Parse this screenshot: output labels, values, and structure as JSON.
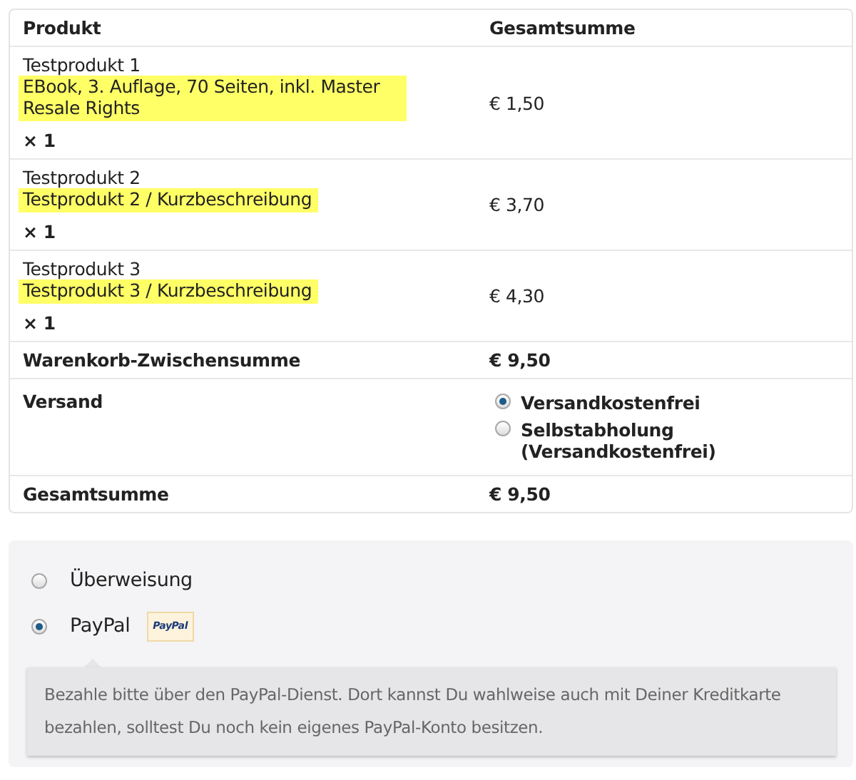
{
  "table": {
    "columns": [
      "Produkt",
      "Gesamtsumme"
    ],
    "items": [
      {
        "name": "Testprodukt 1",
        "description": "EBook, 3. Auflage, 70 Seiten, inkl. Master Resale Rights",
        "quantity": "× 1",
        "total": "€ 1,50"
      },
      {
        "name": "Testprodukt 2",
        "description": "Testprodukt 2 / Kurzbeschreibung",
        "quantity": "× 1",
        "total": "€ 3,70"
      },
      {
        "name": "Testprodukt 3",
        "description": "Testprodukt 3 / Kurzbeschreibung",
        "quantity": "× 1",
        "total": "€ 4,30"
      }
    ],
    "subtotal": {
      "label": "Warenkorb-Zwischensumme",
      "value": "€ 9,50"
    },
    "shipping": {
      "label": "Versand",
      "options": [
        {
          "label": "Versandkostenfrei",
          "selected": true
        },
        {
          "label": "Selbstabholung (Versandkostenfrei)",
          "selected": false
        }
      ]
    },
    "total": {
      "label": "Gesamtsumme",
      "value": "€ 9,50"
    }
  },
  "payment": {
    "methods": [
      {
        "label": "Überweisung",
        "selected": false
      },
      {
        "label": "PayPal",
        "selected": true,
        "logo_text": "PayPal"
      }
    ],
    "description": "Bezahle bitte über den PayPal-Dienst. Dort kannst Du wahlweise auch mit Deiner Kreditkarte bezahlen, solltest Du noch kein eigenes PayPal-Konto besitzen."
  }
}
